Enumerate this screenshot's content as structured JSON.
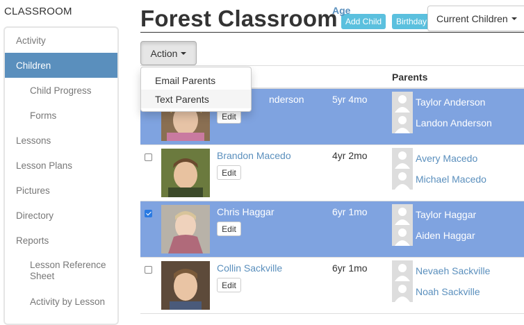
{
  "brand": "CLASSROOM",
  "sidebar": {
    "items": [
      {
        "label": "Activity"
      },
      {
        "label": "Children"
      },
      {
        "label": "Child Progress"
      },
      {
        "label": "Forms"
      },
      {
        "label": "Lessons"
      },
      {
        "label": "Lesson Plans"
      },
      {
        "label": "Pictures"
      },
      {
        "label": "Directory"
      },
      {
        "label": "Reports"
      },
      {
        "label": "Lesson Reference Sheet"
      },
      {
        "label": "Activity by Lesson"
      }
    ]
  },
  "header": {
    "title": "Forest Classroom",
    "add_child": "Add Child",
    "birthday": "Birthday",
    "filter_selected": "Current Children"
  },
  "actions": {
    "button_label": "Action",
    "menu": [
      "Email Parents",
      "Text Parents"
    ]
  },
  "table": {
    "columns": [
      "Age",
      "Parents"
    ],
    "rows": [
      {
        "name": "Sofia Anderson",
        "name_visible": "nderson",
        "age": "5yr 4mo",
        "checked": true,
        "edit": "Edit",
        "parents": [
          "Taylor Anderson",
          "Landon Anderson"
        ]
      },
      {
        "name": "Brandon Macedo",
        "age": "4yr 2mo",
        "checked": false,
        "edit": "Edit",
        "parents": [
          "Avery Macedo",
          "Michael Macedo"
        ]
      },
      {
        "name": "Chris Haggar",
        "age": "6yr 1mo",
        "checked": true,
        "edit": "Edit",
        "parents": [
          "Taylor Haggar",
          "Aiden Haggar"
        ]
      },
      {
        "name": "Collin Sackville",
        "age": "6yr 1mo",
        "checked": false,
        "edit": "Edit",
        "parents": [
          "Nevaeh Sackville",
          "Noah Sackville"
        ]
      }
    ]
  },
  "colors": {
    "accent": "#5a8fbd",
    "selected_row": "#7fa3e0",
    "pill": "#5bc0de"
  }
}
